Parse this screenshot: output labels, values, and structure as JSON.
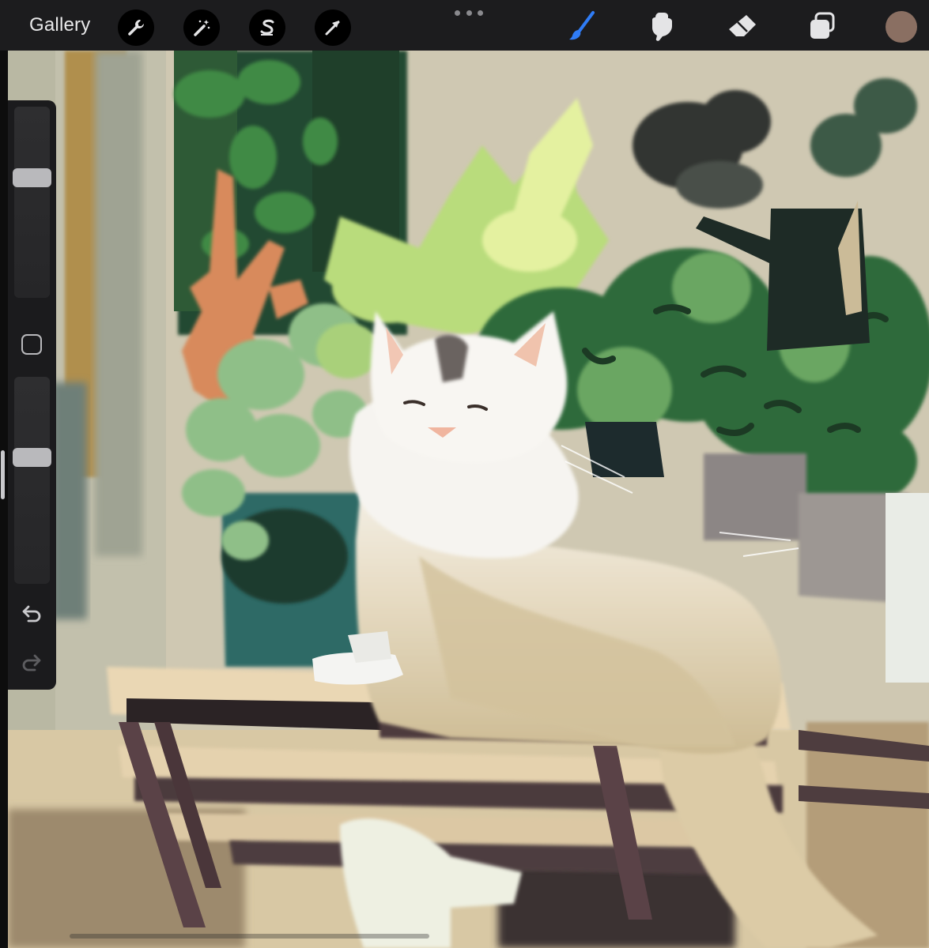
{
  "toolbar": {
    "gallery_label": "Gallery",
    "left_tools": [
      "wrench-icon",
      "magic-wand-icon",
      "selection-s-icon",
      "transform-arrow-icon"
    ],
    "right_tools": [
      "brush-icon",
      "smudge-icon",
      "eraser-icon",
      "layers-icon"
    ],
    "active_tool": "brush-icon",
    "accent_color": "#2f7cf6",
    "current_color": "#8a6f62"
  },
  "sidebar": {
    "brush_size_level": 0.64,
    "opacity_level": 0.62,
    "modify_button": "square-icon",
    "undo": "undo-icon",
    "redo": "redo-icon"
  },
  "canvas": {
    "subject": "painting-of-fluffy-white-cat-with-plants",
    "palette": [
      "#cfc9b2",
      "#2f5a3a",
      "#c9e07a",
      "#e7e0cf",
      "#4b3a3d",
      "#1f2b26"
    ]
  }
}
